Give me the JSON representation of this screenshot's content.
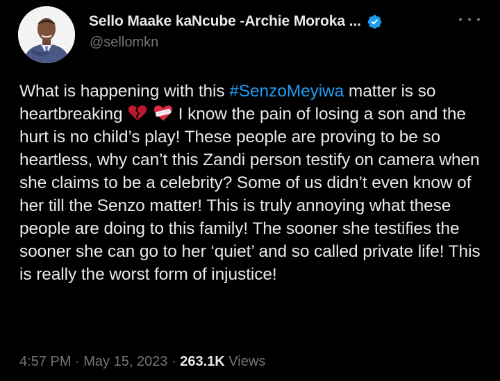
{
  "author": {
    "display_name": "Sello Maake kaNcube -Archie Moroka ...",
    "handle": "@sellomkn",
    "verified": true,
    "avatar_icon": "profile-photo"
  },
  "tweet": {
    "text_1": "What is happening with this ",
    "hashtag": "#SenzoMeyiwa",
    "text_2": " matter is so heartbreaking ",
    "emoji_1": "broken-heart-icon",
    "emoji_2": "mending-heart-icon",
    "text_3": " I know the pain of losing a son and the hurt is no child’s play! These people are proving to be so heartless, why can’t this Zandi person testify on camera when she claims to be a celebrity? Some of us didn’t even know of her till the Senzo matter! This is truly annoying what these people are doing to this family! The sooner she testifies the sooner she can go to her ‘quiet’ and so called private life! This is really the worst form of injustice!"
  },
  "meta": {
    "time": "4:57 PM",
    "separator": " · ",
    "date": "May 15, 2023",
    "views_count": "263.1K",
    "views_label": " Views"
  },
  "colors": {
    "background": "#000000",
    "text": "#e7e9ea",
    "secondary": "#71767b",
    "link": "#1d9bf0",
    "verified": "#1d9bf0"
  }
}
